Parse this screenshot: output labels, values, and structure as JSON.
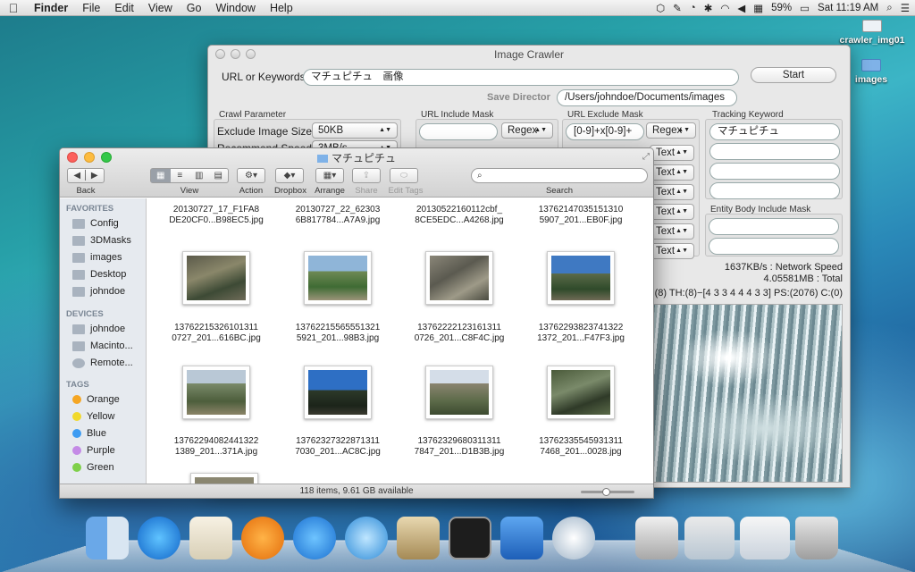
{
  "menubar": {
    "apple": "",
    "app": "Finder",
    "items": [
      "File",
      "Edit",
      "View",
      "Go",
      "Window",
      "Help"
    ],
    "battery": "59%",
    "clock": "Sat 11:19 AM"
  },
  "desktop": {
    "icons": [
      {
        "label": "crawler_img01"
      },
      {
        "label": "images"
      }
    ]
  },
  "crawler": {
    "title": "Image Crawler",
    "url_label": "URL or Keywords",
    "url_value": "マチュピチュ　画像",
    "start_label": "Start",
    "save_label": "Save Director",
    "save_value": "/Users/johndoe/Documents/images",
    "crawl_param_label": "Crawl Parameter",
    "exclude_size_label": "Exclude Image Size",
    "exclude_size_value": "50KB",
    "recommend_speed_label": "Recommend Speed",
    "recommend_speed_value": "3MB/s",
    "include_mask_label": "URL Include Mask",
    "include_mask_value": "",
    "regex_label": "Regex",
    "exclude_mask_label": "URL Exclude Mask",
    "exclude_mask_value": "[0-9]+x[0-9]+",
    "exclude_regex_label": "Regex",
    "text_label": "Text",
    "tracking_label": "Tracking Keyword",
    "tracking_values": [
      "マチュピチュ",
      "",
      "",
      ""
    ],
    "entity_label": "Entity Body Include Mask",
    "speed": "1637KB/s : Network Speed",
    "total": "4.05581MB : Total",
    "threads": "(8) TH:(8)−[4 3 3 4 4 4 3 3] PS:(2076) C:(0)"
  },
  "finder": {
    "title": "マチュピチュ",
    "toolbar": {
      "back": "Back",
      "view": "View",
      "action": "Action",
      "dropbox": "Dropbox",
      "arrange": "Arrange",
      "share": "Share",
      "edit_tags": "Edit Tags",
      "search": "Search"
    },
    "sidebar": {
      "favorites_header": "FAVORITES",
      "favorites": [
        "Config",
        "3DMasks",
        "images",
        "Desktop",
        "johndoe"
      ],
      "devices_header": "DEVICES",
      "devices": [
        "johndoe",
        "Macinto...",
        "Remote..."
      ],
      "tags_header": "TAGS",
      "tags": [
        {
          "name": "Orange",
          "color": "#f5a623"
        },
        {
          "name": "Yellow",
          "color": "#f1d92c"
        },
        {
          "name": "Blue",
          "color": "#3e9cf2"
        },
        {
          "name": "Purple",
          "color": "#c48ae6"
        },
        {
          "name": "Green",
          "color": "#7fd04a"
        }
      ]
    },
    "files": [
      {
        "l1": "20130727_17_F1FA8",
        "l2": "DE20CF0...B98EC5.jpg"
      },
      {
        "l1": "20130727_22_62303",
        "l2": "6B817784...A7A9.jpg"
      },
      {
        "l1": "20130522160112cbf_",
        "l2": "8CE5EDC...A4268.jpg"
      },
      {
        "l1": "13762147035151310",
        "l2": "5907_201...EB0F.jpg"
      },
      {
        "l1": "13762215326101311",
        "l2": "0727_201...616BC.jpg"
      },
      {
        "l1": "13762215565551321",
        "l2": "5921_201...98B3.jpg"
      },
      {
        "l1": "13762222123161311",
        "l2": "0726_201...C8F4C.jpg"
      },
      {
        "l1": "13762293823741322",
        "l2": "1372_201...F47F3.jpg"
      },
      {
        "l1": "13762294082441322",
        "l2": "1389_201...371A.jpg"
      },
      {
        "l1": "13762327322871311",
        "l2": "7030_201...AC8C.jpg"
      },
      {
        "l1": "13762329680311311",
        "l2": "7847_201...D1B3B.jpg"
      },
      {
        "l1": "13762335545931311",
        "l2": "7468_201...0028.jpg"
      }
    ],
    "status": "118 items, 9.61 GB available"
  }
}
